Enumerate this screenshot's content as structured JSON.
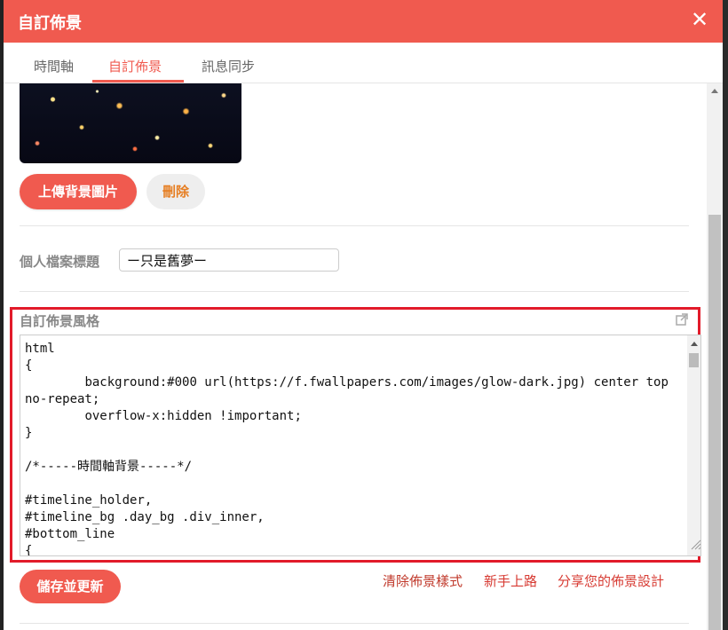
{
  "dialog": {
    "title": "自訂佈景"
  },
  "tabs": [
    {
      "label": "時間軸"
    },
    {
      "label": "自訂佈景",
      "active": true
    },
    {
      "label": "訊息同步"
    }
  ],
  "background": {
    "upload_label": "上傳背景圖片",
    "delete_label": "刪除"
  },
  "profile": {
    "label": "個人檔案標題",
    "value": "ー只是舊夢ー"
  },
  "style": {
    "section_title": "自訂佈景風格",
    "css": "html\n{\n        background:#000 url(https://f.fwallpapers.com/images/glow-dark.jpg) center top no-repeat;\n        overflow-x:hidden !important;\n}\n\n/*-----時間軸背景-----*/\n\n#timeline_holder,\n#timeline_bg .day_bg .div_inner,\n#bottom_line\n{"
  },
  "actions": {
    "save_label": "儲存並更新",
    "links": [
      "清除佈景樣式",
      "新手上路",
      "分享您的佈景設計"
    ]
  },
  "colors": {
    "accent": "#f05a4f",
    "highlight": "#e21b2a",
    "delete_text": "#e67e22",
    "link": "#d73a32"
  },
  "icons": {
    "close": "close-icon",
    "external": "external-link-icon"
  }
}
